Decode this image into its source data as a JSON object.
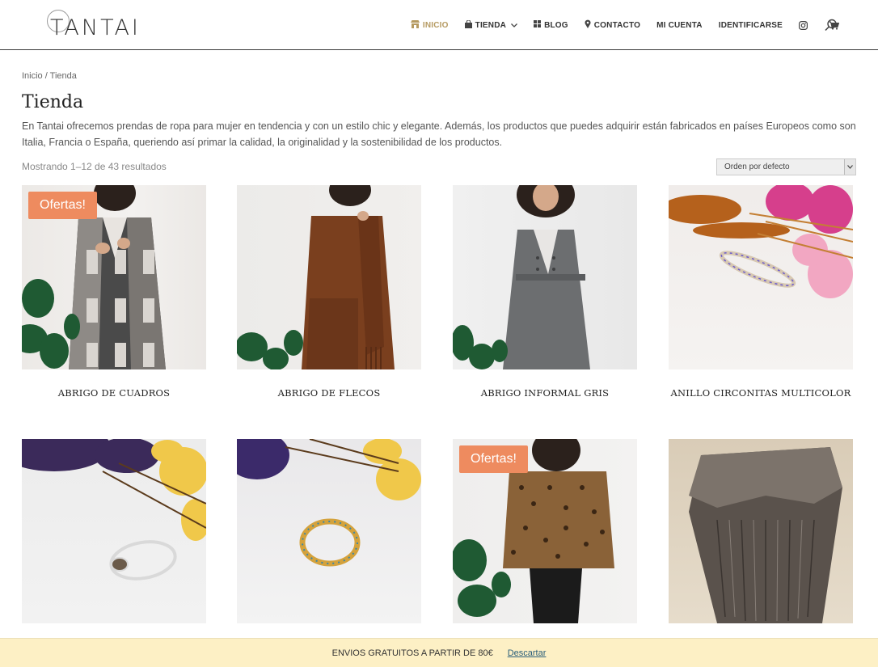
{
  "header": {
    "logo_text": "TANTAI",
    "nav": [
      {
        "label": "INICIO",
        "icon": "store-icon",
        "active": true
      },
      {
        "label": "TIENDA",
        "icon": "bag-icon",
        "has_dropdown": true
      },
      {
        "label": "BLOG",
        "icon": "grid-icon"
      },
      {
        "label": "CONTACTO",
        "icon": "map-pin-icon"
      },
      {
        "label": "MI CUENTA"
      },
      {
        "label": "IDENTIFICARSE"
      }
    ],
    "icons": [
      "instagram-icon",
      "cart-icon",
      "search-icon"
    ],
    "accent_color": "#b59a61"
  },
  "breadcrumb": {
    "home": "Inicio",
    "separator": " / ",
    "current": "Tienda"
  },
  "page": {
    "title": "Tienda",
    "description": "En Tantai ofrecemos prendas de ropa para mujer en tendencia y con un estilo chic y elegante. Además, los productos que puedes adquirir están fabricados en países Europeos como son Italia, Francia o España, queriendo así primar la calidad, la originalidad y la sostenibilidad de los productos.",
    "results": "Mostrando 1–12 de 43 resultados",
    "sort_selected": "Orden por defecto"
  },
  "products": [
    {
      "title": "ABRIGO DE CUADROS",
      "badge": "Ofertas!"
    },
    {
      "title": "ABRIGO DE FLECOS"
    },
    {
      "title": "ABRIGO INFORMAL GRIS"
    },
    {
      "title": "ANILLO CIRCONITAS MULTICOLOR"
    },
    {
      "title": ""
    },
    {
      "title": ""
    },
    {
      "title": "",
      "badge": "Ofertas!"
    },
    {
      "title": ""
    }
  ],
  "banner": {
    "text": "ENVIOS GRATUITOS A PARTIR DE 80€",
    "dismiss": "Descartar",
    "color": "#fdf0c5"
  },
  "badge_color": "#ee8b5f"
}
